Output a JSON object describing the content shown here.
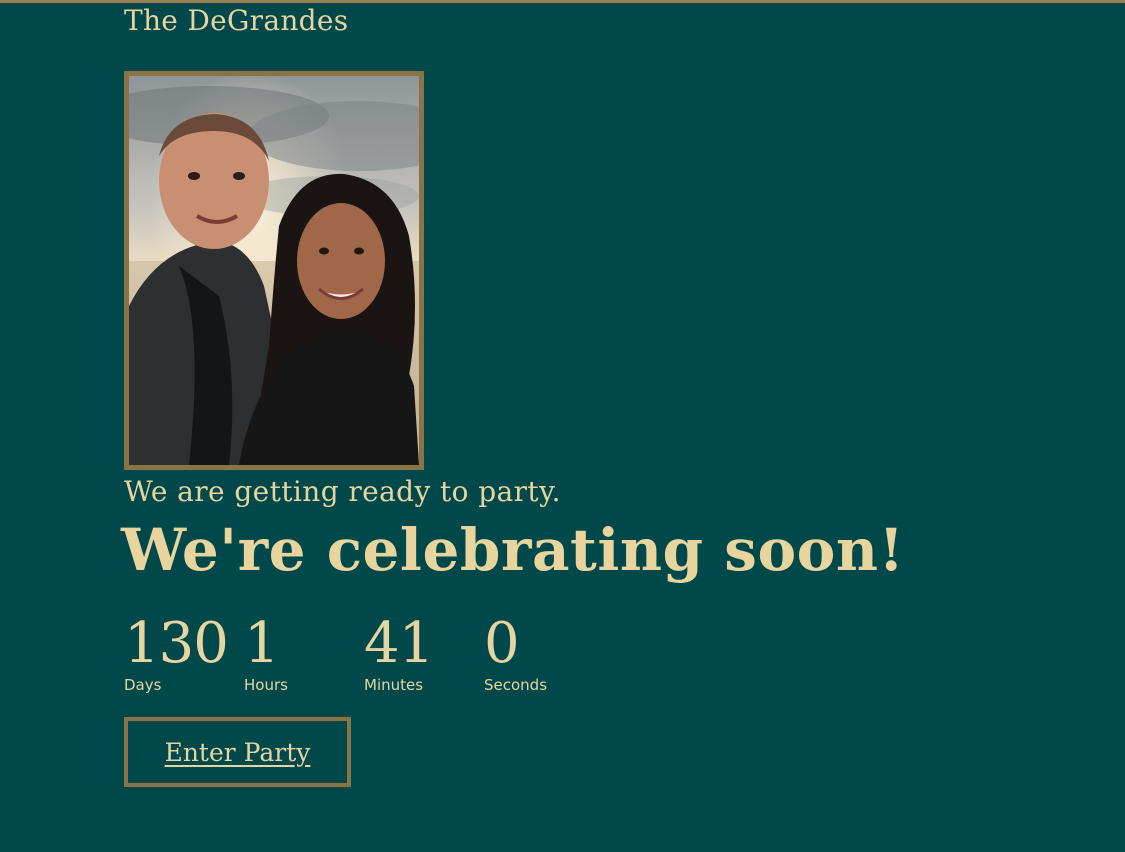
{
  "site": {
    "title": "The DeGrandes"
  },
  "hero": {
    "photo_alt": "couple-selfie",
    "tagline": "We are getting ready to party.",
    "headline": "We're celebrating soon!"
  },
  "countdown": {
    "units": [
      {
        "value": "130",
        "label": "Days"
      },
      {
        "value": "1",
        "label": "Hours"
      },
      {
        "value": "41",
        "label": "Minutes"
      },
      {
        "value": "0",
        "label": "Seconds"
      }
    ]
  },
  "cta": {
    "label": "Enter Party"
  },
  "colors": {
    "background": "#01484a",
    "text": "#e6d4a1",
    "accent_border": "#8a7447"
  }
}
